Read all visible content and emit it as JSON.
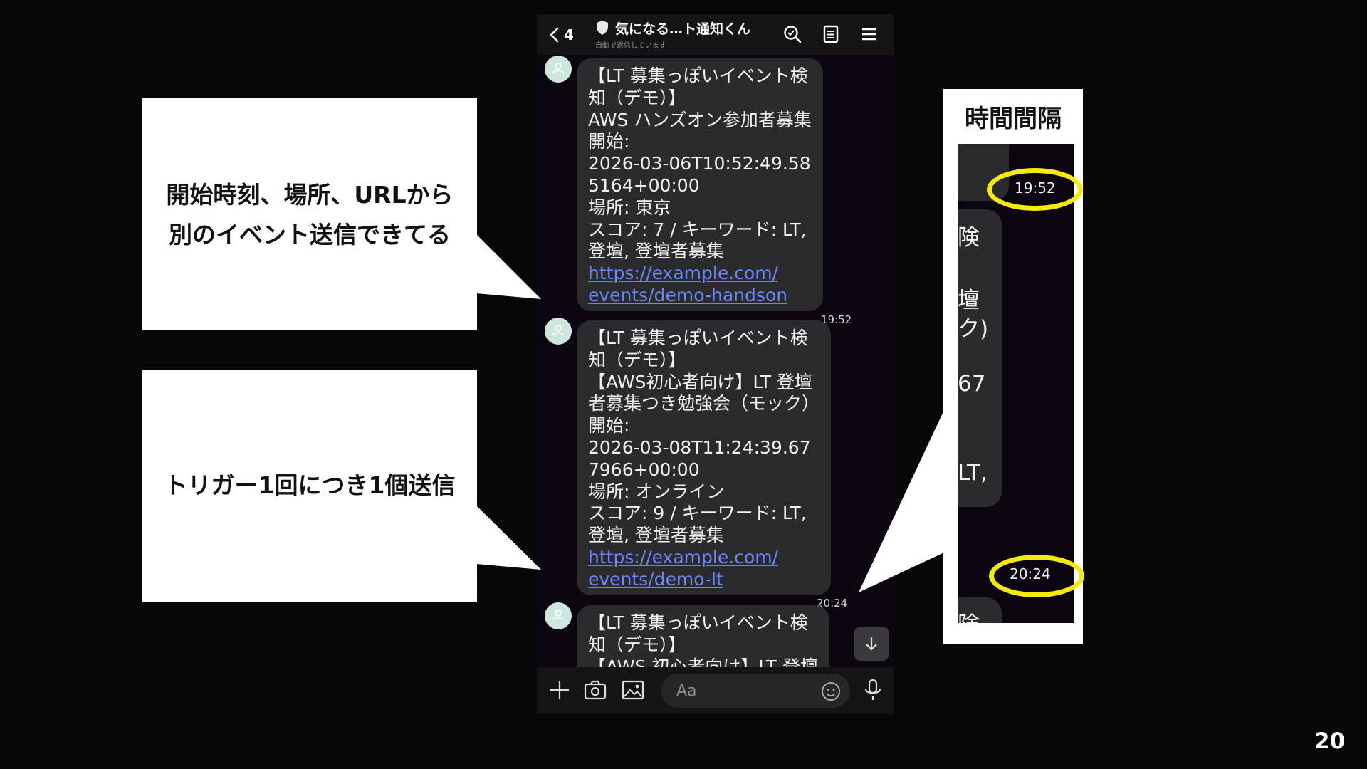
{
  "chat": {
    "back_count": "4",
    "title": "気になる…ト通知くん",
    "subtitle": "自動で返信しています",
    "messages": [
      {
        "lines": [
          "【LT 募集っぽいイベント検",
          "知（デモ）】",
          "AWS ハンズオン参加者募集",
          "開始:",
          "2026-03-06T10:52:49.58",
          "5164+00:00",
          "場所: 東京",
          "スコア: 7 / キーワード: LT,",
          "登壇, 登壇者募集"
        ],
        "link_lines": [
          "https://example.com/",
          "events/demo-handson"
        ],
        "time": "19:52"
      },
      {
        "lines": [
          "【LT 募集っぽいイベント検",
          "知（デモ）】",
          "【AWS初心者向け】LT 登壇",
          "者募集つき勉強会（モック）",
          "開始:",
          "2026-03-08T11:24:39.67",
          "7966+00:00",
          "場所: オンライン",
          "スコア: 9 / キーワード: LT,",
          "登壇, 登壇者募集"
        ],
        "link_lines": [
          "https://example.com/",
          "events/demo-lt"
        ],
        "time": "20:24"
      },
      {
        "lines": [
          "【LT 募集っぽいイベント検",
          "知（デモ）】",
          "【AWS 初心者向け】LT 登壇"
        ]
      }
    ],
    "input_placeholder": "Aa"
  },
  "callouts": [
    {
      "lines": [
        "開始時刻、場所、URLから",
        "別のイベント送信できてる"
      ]
    },
    {
      "lines": [
        "トリガー1回につき1個送信"
      ]
    }
  ],
  "interval_panel": {
    "title": "時間間隔",
    "fragments": [
      "険",
      "壇",
      "ク)",
      "67",
      "LT,",
      "険"
    ],
    "times": [
      "19:52",
      "20:24"
    ]
  },
  "page_number": "20",
  "colors": {
    "highlight_ring": "#f5ea0a",
    "link": "#6d86ff",
    "bubble": "#2b2b2e"
  }
}
